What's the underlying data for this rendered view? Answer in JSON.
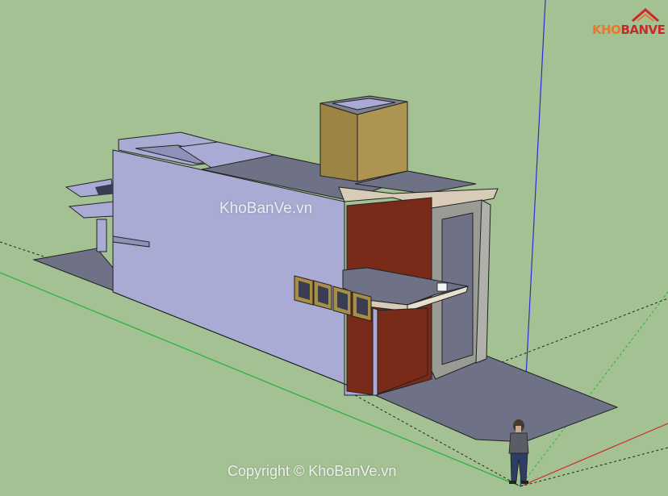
{
  "viewport": {
    "background": "#a3c193",
    "axes": {
      "red": "#d22a2a",
      "green": "#23b33a",
      "blue": "#2b2bd6"
    }
  },
  "logo": {
    "part1": "KHO",
    "part2": "BANVE",
    "icon": "house-roof-icon"
  },
  "watermark": "KhoBanVe.vn",
  "copyright": "Copyright © KhoBanVe.vn",
  "model": {
    "wall_color": "#a9abd4",
    "chimney_color": "#a88d45",
    "brick_color": "#7a2a18",
    "ground_color": "#6f7186",
    "frame_color": "#9b9b96"
  },
  "figure": {
    "icon": "person-figure-icon"
  }
}
